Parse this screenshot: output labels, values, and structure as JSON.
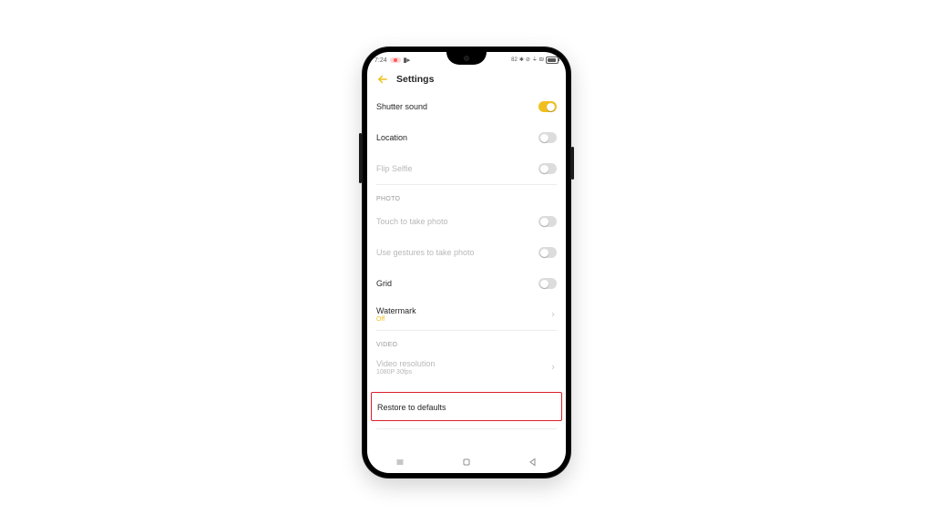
{
  "statusbar": {
    "time": "7:24",
    "battery_text": "82"
  },
  "header": {
    "title": "Settings"
  },
  "general": {
    "shutter_sound": {
      "label": "Shutter sound",
      "on": true
    },
    "location": {
      "label": "Location",
      "on": false
    },
    "flip_selfie": {
      "label": "Flip Selfie",
      "on": false,
      "disabled": true
    }
  },
  "photo": {
    "section": "PHOTO",
    "touch": {
      "label": "Touch to take photo",
      "on": false,
      "disabled": true
    },
    "gestures": {
      "label": "Use gestures to take photo",
      "on": false,
      "disabled": true
    },
    "grid": {
      "label": "Grid",
      "on": false
    },
    "watermark": {
      "label": "Watermark",
      "value": "Off"
    }
  },
  "video": {
    "section": "VIDEO",
    "resolution": {
      "label": "Video resolution",
      "value": "1080P 30fps",
      "disabled": true
    }
  },
  "restore": {
    "label": "Restore to defaults"
  }
}
